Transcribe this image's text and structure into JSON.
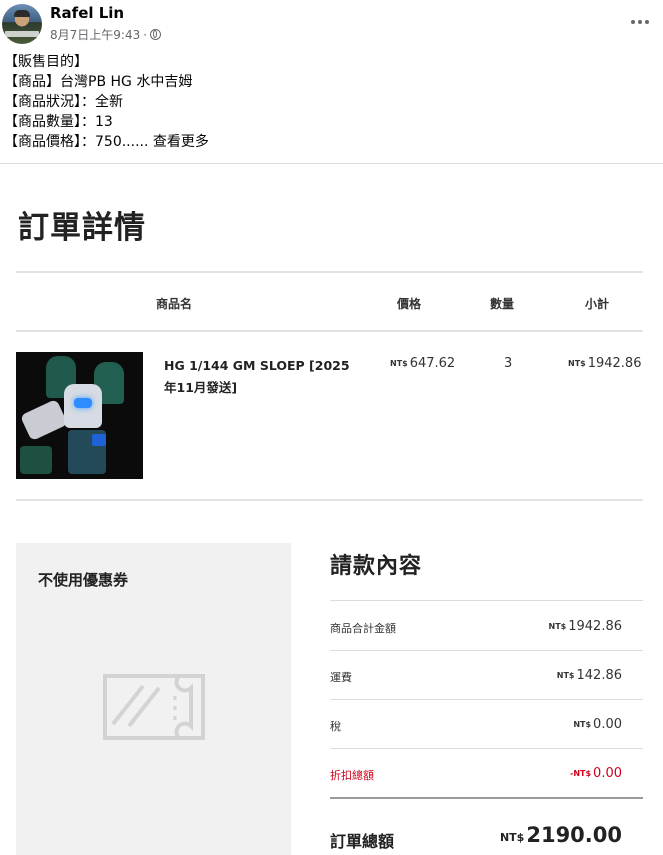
{
  "post": {
    "author": "Rafel Lin",
    "timestamp": "8月7日上午9:43",
    "separator": "·",
    "privacy_icon": "globe-icon",
    "more_icon": "more-options-icon",
    "lines": [
      "【販售目的】",
      "【商品】台灣PB HG 水中吉姆",
      "【商品狀況】：全新",
      "【商品數量】：13",
      "【商品價格】：750......"
    ],
    "see_more": "查看更多"
  },
  "order": {
    "title": "訂單詳情",
    "headers": {
      "name": "商品名",
      "price": "價格",
      "qty": "數量",
      "subtotal": "小計"
    },
    "currency": "NT$",
    "item": {
      "name": "HG 1/144 GM SLOEP [2025年11月發送]",
      "price": "647.62",
      "qty": "3",
      "subtotal": "1942.86"
    },
    "coupon": {
      "title": "不使用優惠券",
      "icon": "ticket-icon"
    },
    "billing": {
      "title": "請款內容",
      "rows": [
        {
          "label": "商品合計金額",
          "value": "1942.86",
          "prefix": "NT$"
        },
        {
          "label": "運費",
          "value": "142.86",
          "prefix": "NT$"
        },
        {
          "label": "稅",
          "value": "0.00",
          "prefix": "NT$"
        },
        {
          "label": "折扣總額",
          "value": "0.00",
          "prefix": "-NT$"
        }
      ],
      "total_label": "訂單總額",
      "total_value": "2190.00",
      "discount_color": "#d0021b"
    }
  }
}
